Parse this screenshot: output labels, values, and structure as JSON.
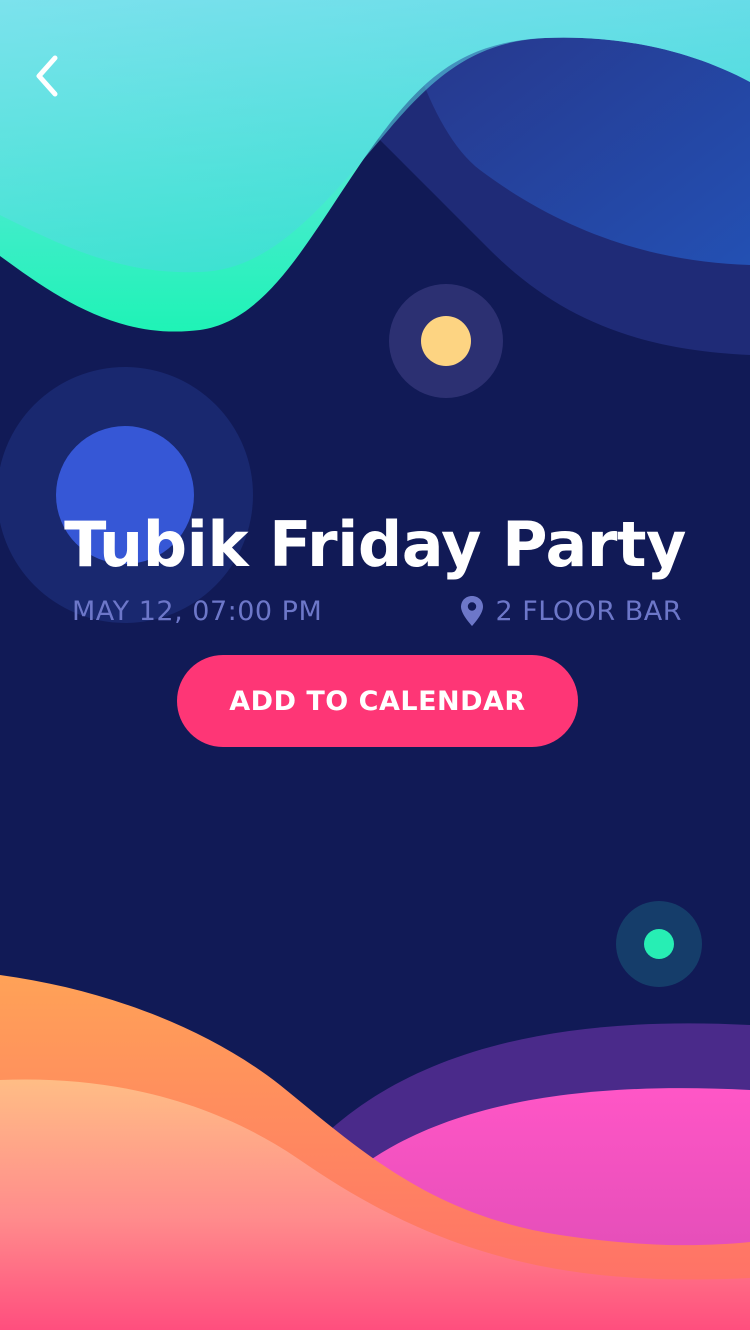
{
  "event": {
    "title": "Tubik Friday Party",
    "datetime": "MAY 12, 07:00 PM",
    "location": "2 FLOOR BAR"
  },
  "actions": {
    "add_to_calendar_label": "ADD TO CALENDAR"
  },
  "icons": {
    "back": "chevron-left-icon",
    "location": "location-pin-icon"
  },
  "colors": {
    "background": "#111a56",
    "accent": "#fe3676",
    "meta_text": "#6d77c9",
    "dot_yellow": "#fdd482",
    "dot_blue": "#3657d6",
    "dot_green": "#27eeb4"
  }
}
